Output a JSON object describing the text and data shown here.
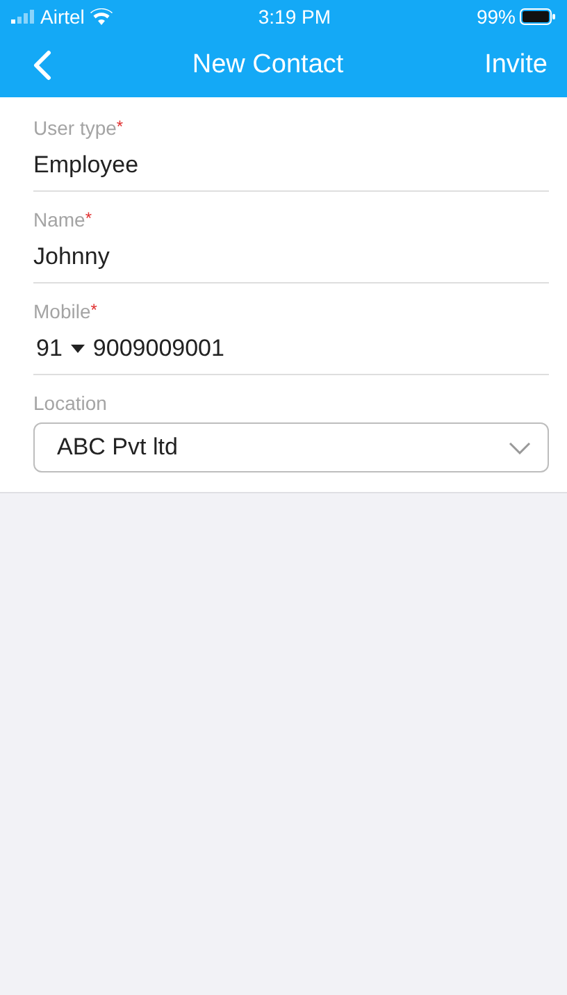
{
  "status_bar": {
    "carrier": "Airtel",
    "time": "3:19 PM",
    "battery": "99%"
  },
  "nav_bar": {
    "title": "New Contact",
    "action": "Invite"
  },
  "fields": [
    {
      "kind": "text",
      "label": "User type",
      "required_mark": "*",
      "value": "Employee"
    },
    {
      "kind": "text",
      "label": "Name",
      "required_mark": "*",
      "value": "Johnny"
    },
    {
      "kind": "phone",
      "label": "Mobile",
      "required_mark": "*",
      "code": "91",
      "value": "9009009001"
    },
    {
      "kind": "select",
      "label": "Location",
      "value": "ABC Pvt ltd"
    }
  ]
}
